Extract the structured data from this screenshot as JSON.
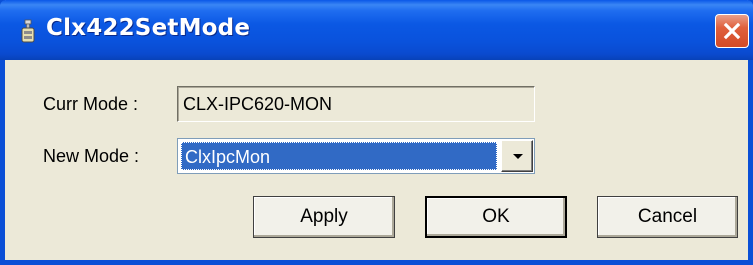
{
  "window": {
    "title": "Clx422SetMode",
    "app_icon": "app-icon",
    "close_icon": "close-icon"
  },
  "form": {
    "curr_mode_label": "Curr Mode :",
    "curr_mode_value": "CLX-IPC620-MON",
    "new_mode_label": "New Mode :",
    "new_mode_selected": "ClxIpcMon",
    "dropdown_icon": "chevron-down-icon"
  },
  "buttons": {
    "apply": "Apply",
    "ok": "OK",
    "cancel": "Cancel"
  },
  "colors": {
    "titlebar": "#0a52dc",
    "dialog_bg": "#ece9d8",
    "selection": "#316ac5",
    "close_button": "#e0603c"
  }
}
